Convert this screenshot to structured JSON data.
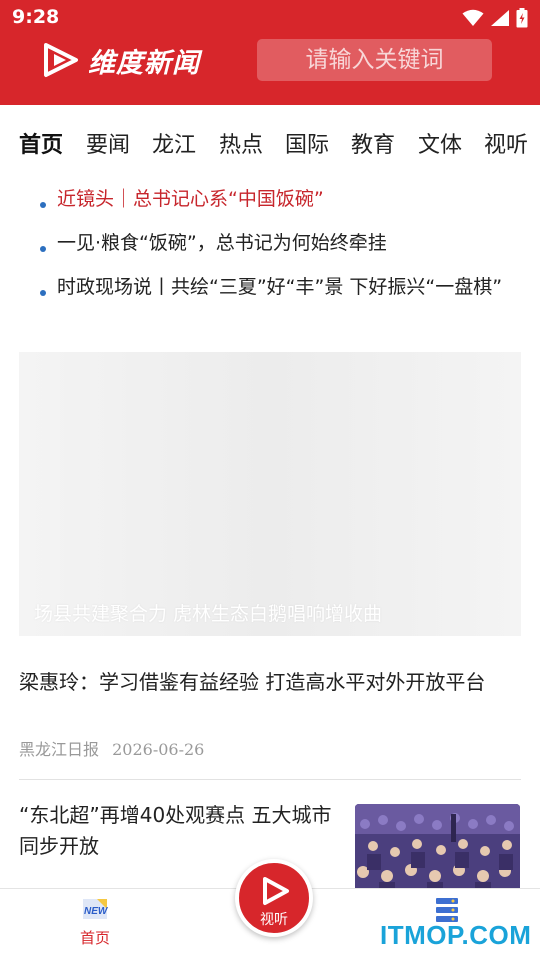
{
  "status_bar": {
    "time": "9:28",
    "icons": [
      "wifi-icon",
      "signal-icon",
      "battery-icon"
    ]
  },
  "header": {
    "logo_text": "维度新闻",
    "search_placeholder": "请输入关键词",
    "background_color": "#d7262b"
  },
  "tabs": [
    {
      "label": "首页",
      "active": true
    },
    {
      "label": "要闻",
      "active": false
    },
    {
      "label": "龙江",
      "active": false
    },
    {
      "label": "热点",
      "active": false
    },
    {
      "label": "国际",
      "active": false
    },
    {
      "label": "教育",
      "active": false
    },
    {
      "label": "文体",
      "active": false
    },
    {
      "label": "视听",
      "active": false
    }
  ],
  "headlines": [
    {
      "text": "近镜头｜总书记心系“中国饭碗”",
      "highlight": true
    },
    {
      "text": "一见·粮食“饭碗”，总书记为何始终牵挂",
      "highlight": false
    },
    {
      "text": "时政现场说丨共绘“三夏”好“丰”景 下好振兴“一盘棋”",
      "highlight": false
    }
  ],
  "banner": {
    "caption": "场县共建聚合力 虎林生态白鹅唱响增收曲"
  },
  "articles": [
    {
      "title": "梁惠玲：学习借鉴有益经验 打造高水平对外开放平台",
      "source": "黑龙江日报",
      "date": "2026-06-26"
    },
    {
      "title": "“东北超”再增40处观赛点 五大城市同步开放",
      "has_thumbnail": true
    }
  ],
  "bottom_nav": {
    "home_label": "首页",
    "center_label": "视听",
    "right_icon": "server-stack-icon"
  },
  "watermark": "ITMOP.COM",
  "colors": {
    "brand_red": "#d7262b",
    "highlight_red": "#c7262c",
    "bullet_blue": "#2c6fbf",
    "active_tab_underline": "#f7d64a"
  }
}
